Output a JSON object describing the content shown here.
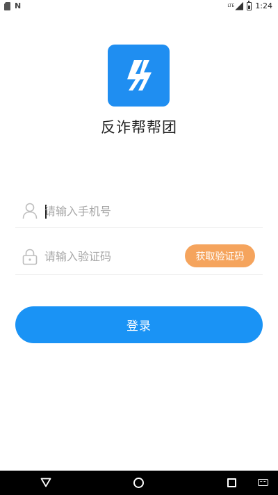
{
  "status_bar": {
    "left_icons": [
      "sd-card-icon",
      "n-notification-icon"
    ],
    "network_label": "LTE",
    "time": "1:24"
  },
  "app": {
    "name": "反诈帮帮团",
    "logo_icon": "lightning-logo-icon",
    "brand_color": "#1f8ef1"
  },
  "form": {
    "phone": {
      "placeholder": "请输入手机号",
      "value": "",
      "icon": "user-icon"
    },
    "code": {
      "placeholder": "请输入验证码",
      "value": "",
      "icon": "lock-icon"
    },
    "get_code_label": "获取验证码",
    "get_code_color": "#f5a45d",
    "login_label": "登录",
    "login_color": "#1a93f5"
  },
  "nav_bar": {
    "buttons": [
      "back-icon",
      "home-icon",
      "recents-icon",
      "keyboard-icon"
    ]
  }
}
